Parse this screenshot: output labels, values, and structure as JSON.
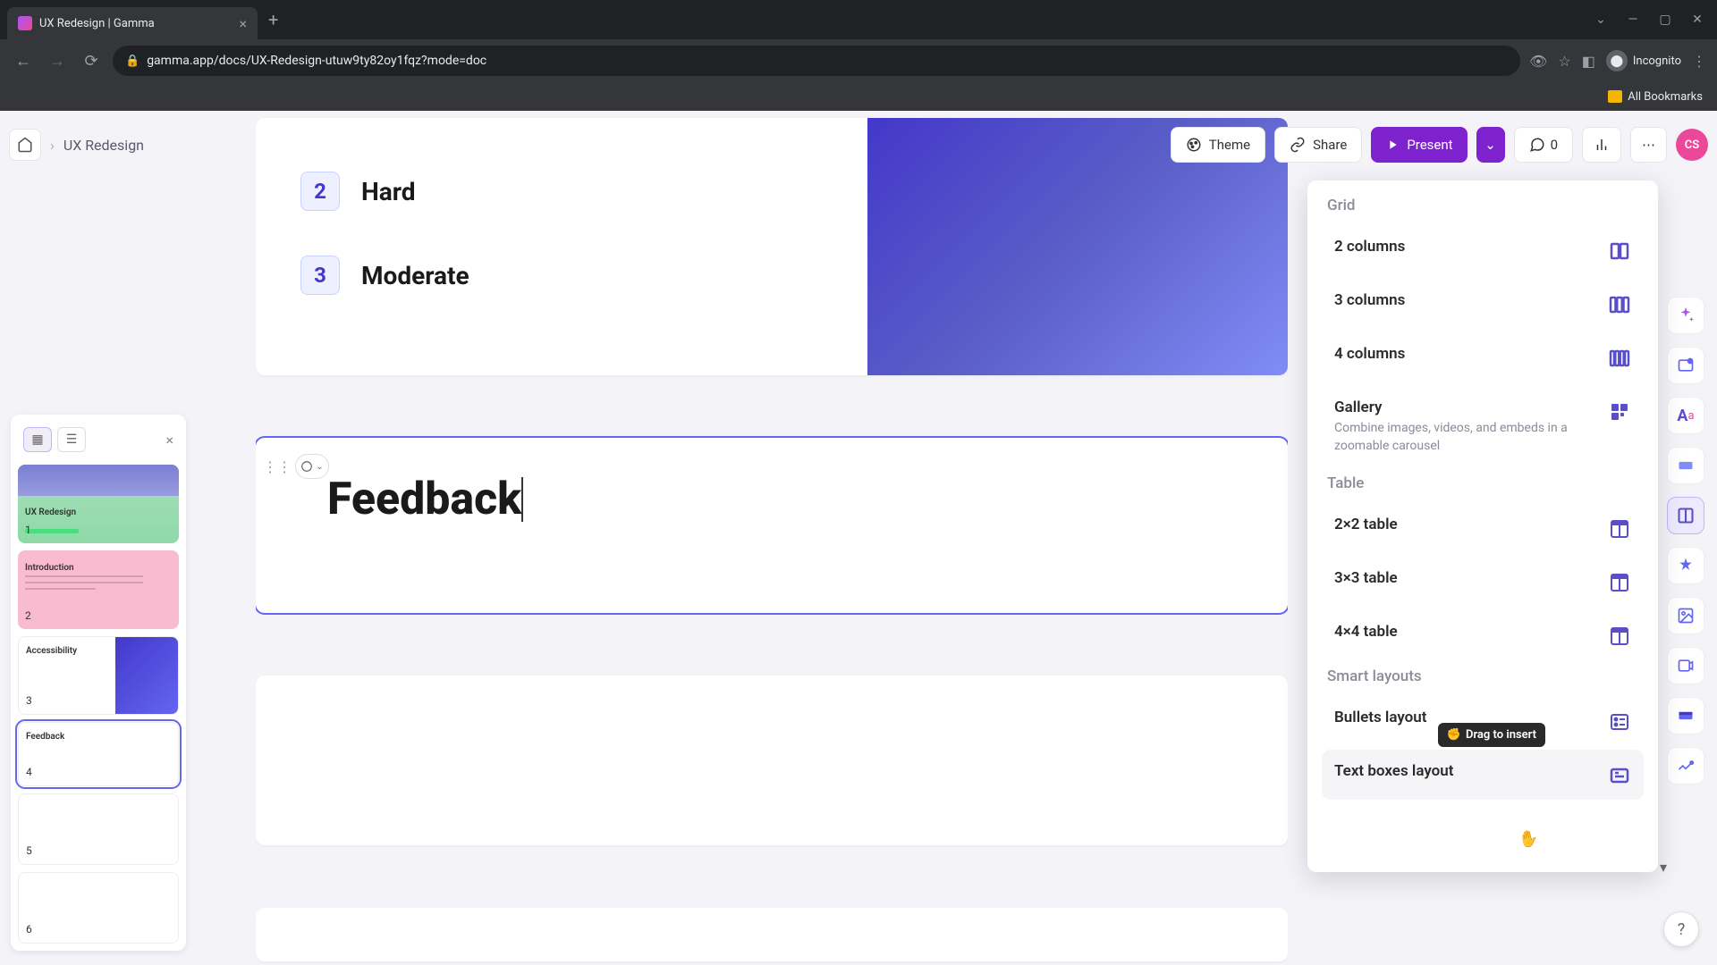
{
  "browser": {
    "tab_title": "UX Redesign | Gamma",
    "url": "gamma.app/docs/UX-Redesign-utuw9ty82oy1fqz?mode=doc",
    "incognito_label": "Incognito",
    "all_bookmarks": "All Bookmarks"
  },
  "toolbar": {
    "doc_name": "UX Redesign",
    "theme_label": "Theme",
    "share_label": "Share",
    "present_label": "Present",
    "comment_count": "0",
    "avatar_initials": "CS"
  },
  "slides": [
    {
      "num": "1",
      "label": "UX Redesign"
    },
    {
      "num": "2",
      "label": "Introduction"
    },
    {
      "num": "3",
      "label": "Accessibility"
    },
    {
      "num": "4",
      "label": "Feedback"
    },
    {
      "num": "5",
      "label": ""
    },
    {
      "num": "6",
      "label": ""
    }
  ],
  "canvas": {
    "item2_num": "2",
    "item2_text": "Hard",
    "item3_num": "3",
    "item3_text": "Moderate",
    "feedback_title": "Feedback"
  },
  "insert_panel": {
    "grid_heading": "Grid",
    "grid_items": [
      {
        "title": "2 columns"
      },
      {
        "title": "3 columns"
      },
      {
        "title": "4 columns"
      },
      {
        "title": "Gallery",
        "desc": "Combine images, videos, and embeds in a zoomable carousel"
      }
    ],
    "table_heading": "Table",
    "table_items": [
      {
        "title": "2×2 table"
      },
      {
        "title": "3×3 table"
      },
      {
        "title": "4×4 table"
      }
    ],
    "smart_heading": "Smart layouts",
    "smart_items": [
      {
        "title": "Bullets layout"
      },
      {
        "title": "Text boxes layout"
      }
    ],
    "drag_hint": "Drag to insert"
  },
  "help": "?"
}
